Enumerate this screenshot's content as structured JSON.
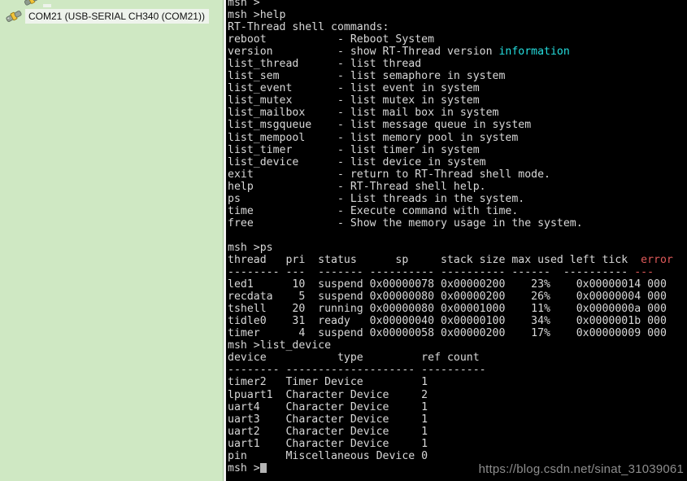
{
  "device_panel": {
    "background_color": "#cfe8c3",
    "items": [
      {
        "label": "",
        "icon": "serial-port-icon",
        "partial": true,
        "selected": false
      },
      {
        "label": "COM21  (USB-SERIAL CH340 (COM21))",
        "icon": "serial-port-icon",
        "partial": false,
        "selected": true
      }
    ]
  },
  "terminal": {
    "background_color": "#000000",
    "foreground_color": "#d8d8d8",
    "accent_cyan": "#25dfe0",
    "accent_red": "#e05a5a",
    "prompt": "msh >",
    "cursor_color": "#b5b5b5",
    "lines": [
      {
        "text": "msh >"
      },
      {
        "text": "msh >help"
      },
      {
        "text": "RT-Thread shell commands:"
      },
      {
        "text": "reboot           - Reboot System"
      },
      {
        "parts": [
          {
            "t": "version          - show RT-Thread version "
          },
          {
            "t": "information",
            "c": "cyan"
          }
        ]
      },
      {
        "text": "list_thread      - list thread"
      },
      {
        "text": "list_sem         - list semaphore in system"
      },
      {
        "text": "list_event       - list event in system"
      },
      {
        "text": "list_mutex       - list mutex in system"
      },
      {
        "text": "list_mailbox     - list mail box in system"
      },
      {
        "text": "list_msgqueue    - list message queue in system"
      },
      {
        "text": "list_mempool     - list memory pool in system"
      },
      {
        "text": "list_timer       - list timer in system"
      },
      {
        "text": "list_device      - list device in system"
      },
      {
        "text": "exit             - return to RT-Thread shell mode."
      },
      {
        "text": "help             - RT-Thread shell help."
      },
      {
        "text": "ps               - List threads in the system."
      },
      {
        "text": "time             - Execute command with time."
      },
      {
        "text": "free             - Show the memory usage in the system."
      },
      {
        "text": ""
      },
      {
        "text": "msh >ps"
      },
      {
        "parts": [
          {
            "t": "thread   pri  status      sp     stack size max used left tick  "
          },
          {
            "t": "error",
            "c": "red"
          }
        ]
      },
      {
        "parts": [
          {
            "t": "-------- ---  ------- ---------- ---------- ------  ---------- "
          },
          {
            "t": "---",
            "c": "red"
          }
        ]
      },
      {
        "text": "led1      10  suspend 0x00000078 0x00000200    23%    0x00000014 000"
      },
      {
        "text": "recdata    5  suspend 0x00000080 0x00000200    26%    0x00000004 000"
      },
      {
        "text": "tshell    20  running 0x00000080 0x00001000    11%    0x0000000a 000"
      },
      {
        "text": "tidle0    31  ready   0x00000040 0x00000100    34%    0x0000001b 000"
      },
      {
        "text": "timer      4  suspend 0x00000058 0x00000200    17%    0x00000009 000"
      },
      {
        "text": "msh >list_device"
      },
      {
        "text": "device           type         ref count"
      },
      {
        "text": "-------- -------------------- ----------"
      },
      {
        "text": "timer2   Timer Device         1"
      },
      {
        "text": "lpuart1  Character Device     2"
      },
      {
        "text": "uart4    Character Device     1"
      },
      {
        "text": "uart3    Character Device     1"
      },
      {
        "text": "uart2    Character Device     1"
      },
      {
        "text": "uart1    Character Device     1"
      },
      {
        "text": "pin      Miscellaneous Device 0"
      },
      {
        "text": "msh >",
        "cursor": true
      }
    ],
    "ps_table": {
      "headers": [
        "thread",
        "pri",
        "status",
        "sp",
        "stack size",
        "max used",
        "left tick",
        "error"
      ],
      "rows": [
        [
          "led1",
          "10",
          "suspend",
          "0x00000078",
          "0x00000200",
          "23%",
          "0x00000014",
          "000"
        ],
        [
          "recdata",
          "5",
          "suspend",
          "0x00000080",
          "0x00000200",
          "26%",
          "0x00000004",
          "000"
        ],
        [
          "tshell",
          "20",
          "running",
          "0x00000080",
          "0x00001000",
          "11%",
          "0x0000000a",
          "000"
        ],
        [
          "tidle0",
          "31",
          "ready",
          "0x00000040",
          "0x00000100",
          "34%",
          "0x0000001b",
          "000"
        ],
        [
          "timer",
          "4",
          "suspend",
          "0x00000058",
          "0x00000200",
          "17%",
          "0x00000009",
          "000"
        ]
      ]
    },
    "device_table": {
      "headers": [
        "device",
        "type",
        "ref count"
      ],
      "rows": [
        [
          "timer2",
          "Timer Device",
          "1"
        ],
        [
          "lpuart1",
          "Character Device",
          "2"
        ],
        [
          "uart4",
          "Character Device",
          "1"
        ],
        [
          "uart3",
          "Character Device",
          "1"
        ],
        [
          "uart2",
          "Character Device",
          "1"
        ],
        [
          "uart1",
          "Character Device",
          "1"
        ],
        [
          "pin",
          "Miscellaneous Device",
          "0"
        ]
      ]
    },
    "help_commands": [
      [
        "reboot",
        "Reboot System"
      ],
      [
        "version",
        "show RT-Thread version information"
      ],
      [
        "list_thread",
        "list thread"
      ],
      [
        "list_sem",
        "list semaphore in system"
      ],
      [
        "list_event",
        "list event in system"
      ],
      [
        "list_mutex",
        "list mutex in system"
      ],
      [
        "list_mailbox",
        "list mail box in system"
      ],
      [
        "list_msgqueue",
        "list message queue in system"
      ],
      [
        "list_mempool",
        "list memory pool in system"
      ],
      [
        "list_timer",
        "list timer in system"
      ],
      [
        "list_device",
        "list device in system"
      ],
      [
        "exit",
        "return to RT-Thread shell mode."
      ],
      [
        "help",
        "RT-Thread shell help."
      ],
      [
        "ps",
        "List threads in the system."
      ],
      [
        "time",
        "Execute command with time."
      ],
      [
        "free",
        "Show the memory usage in the system."
      ]
    ]
  },
  "watermark": {
    "text": "https://blog.csdn.net/sinat_31039061"
  }
}
